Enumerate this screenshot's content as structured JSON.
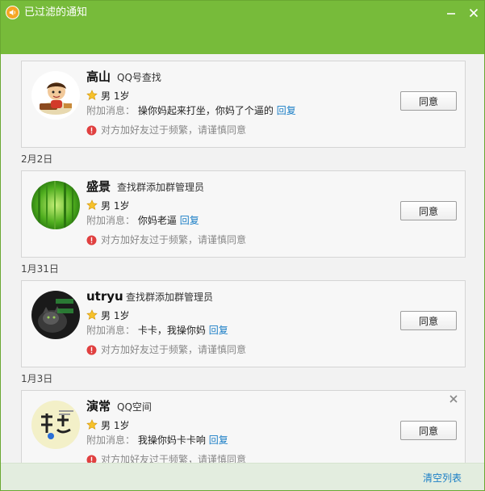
{
  "window": {
    "title": "已过滤的通知",
    "accent_color": "#77bb3a"
  },
  "labels": {
    "extra_label": "附加消息：",
    "reply": "回复",
    "agree": "同意",
    "warning": "对方加好友过于频繁，请谨慎同意",
    "clear": "清空列表"
  },
  "requests": [
    {
      "name": "高山",
      "source": "QQ号查找",
      "gender_age": "男 1岁",
      "message": "操你妈起来打坐，你妈了个逼的",
      "avatar": "cartoon-avatar"
    },
    {
      "date": "2月2日",
      "name": "盛景",
      "source": "查找群添加群管理员",
      "gender_age": "男 1岁",
      "message": "你妈老逼",
      "avatar": "bamboo-avatar"
    },
    {
      "date": "1月31日",
      "name": "utryu",
      "source": "查找群添加群管理员",
      "gender_age": "男 1岁",
      "message": "卡卡，我操你妈",
      "avatar": "dark-cat-avatar"
    },
    {
      "date": "1月3日",
      "name": "演常",
      "source": "QQ空间",
      "gender_age": "男 1岁",
      "message": "我操你妈卡卡响",
      "avatar": "text-logo-avatar"
    }
  ]
}
